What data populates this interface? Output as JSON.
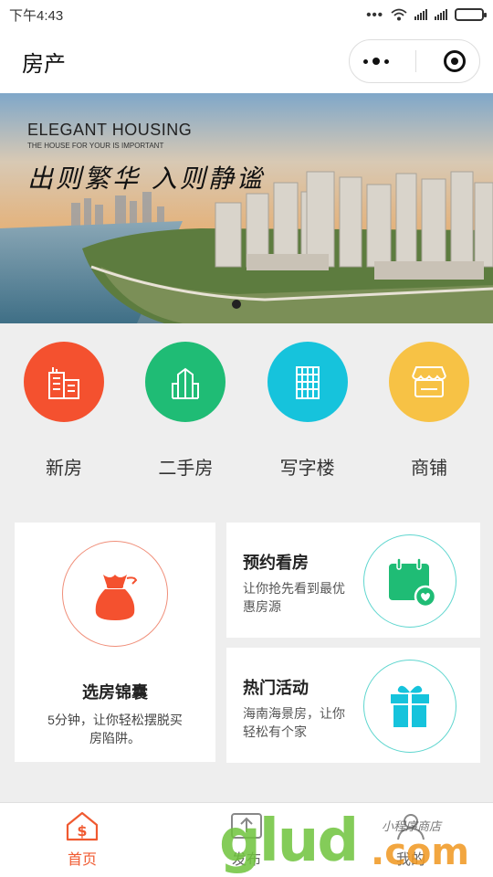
{
  "status_bar": {
    "time": "下午4:43",
    "dots": "•••"
  },
  "navbar": {
    "title": "房产"
  },
  "banner": {
    "heading": "ELEGANT HOUSING",
    "subheading": "THE HOUSE FOR YOUR IS IMPORTANT",
    "slogan": "出则繁华 入则静谧"
  },
  "categories": [
    {
      "label": "新房",
      "icon": "buildings-icon",
      "color": "#f4512f"
    },
    {
      "label": "二手房",
      "icon": "tower-icon",
      "color": "#1fbc75"
    },
    {
      "label": "写字楼",
      "icon": "office-building-icon",
      "color": "#16c3dc"
    },
    {
      "label": "商铺",
      "icon": "shop-icon",
      "color": "#f7c245"
    }
  ],
  "cards": {
    "guide": {
      "title": "选房锦囊",
      "desc": "5分钟，让你轻松摆脱买房陷阱。",
      "icon": "money-bag-icon",
      "color": "#f4512f"
    },
    "appointment": {
      "title": "预约看房",
      "desc": "让你抢先看到最优惠房源",
      "icon": "calendar-check-icon",
      "color": "#1fbc75"
    },
    "events": {
      "title": "热门活动",
      "desc": "海南海景房，让你轻松有个家",
      "icon": "gift-icon",
      "color": "#16c3dc"
    }
  },
  "tabbar": [
    {
      "label": "首页",
      "icon": "home-dollar-icon",
      "active": true
    },
    {
      "label": "发布",
      "icon": "publish-icon",
      "active": false
    },
    {
      "label": "我的",
      "icon": "profile-icon",
      "active": false
    }
  ],
  "watermark": {
    "text": "glud",
    "suffix": ".com",
    "handwriting": "小程序商店"
  },
  "accent": "#f05a31"
}
